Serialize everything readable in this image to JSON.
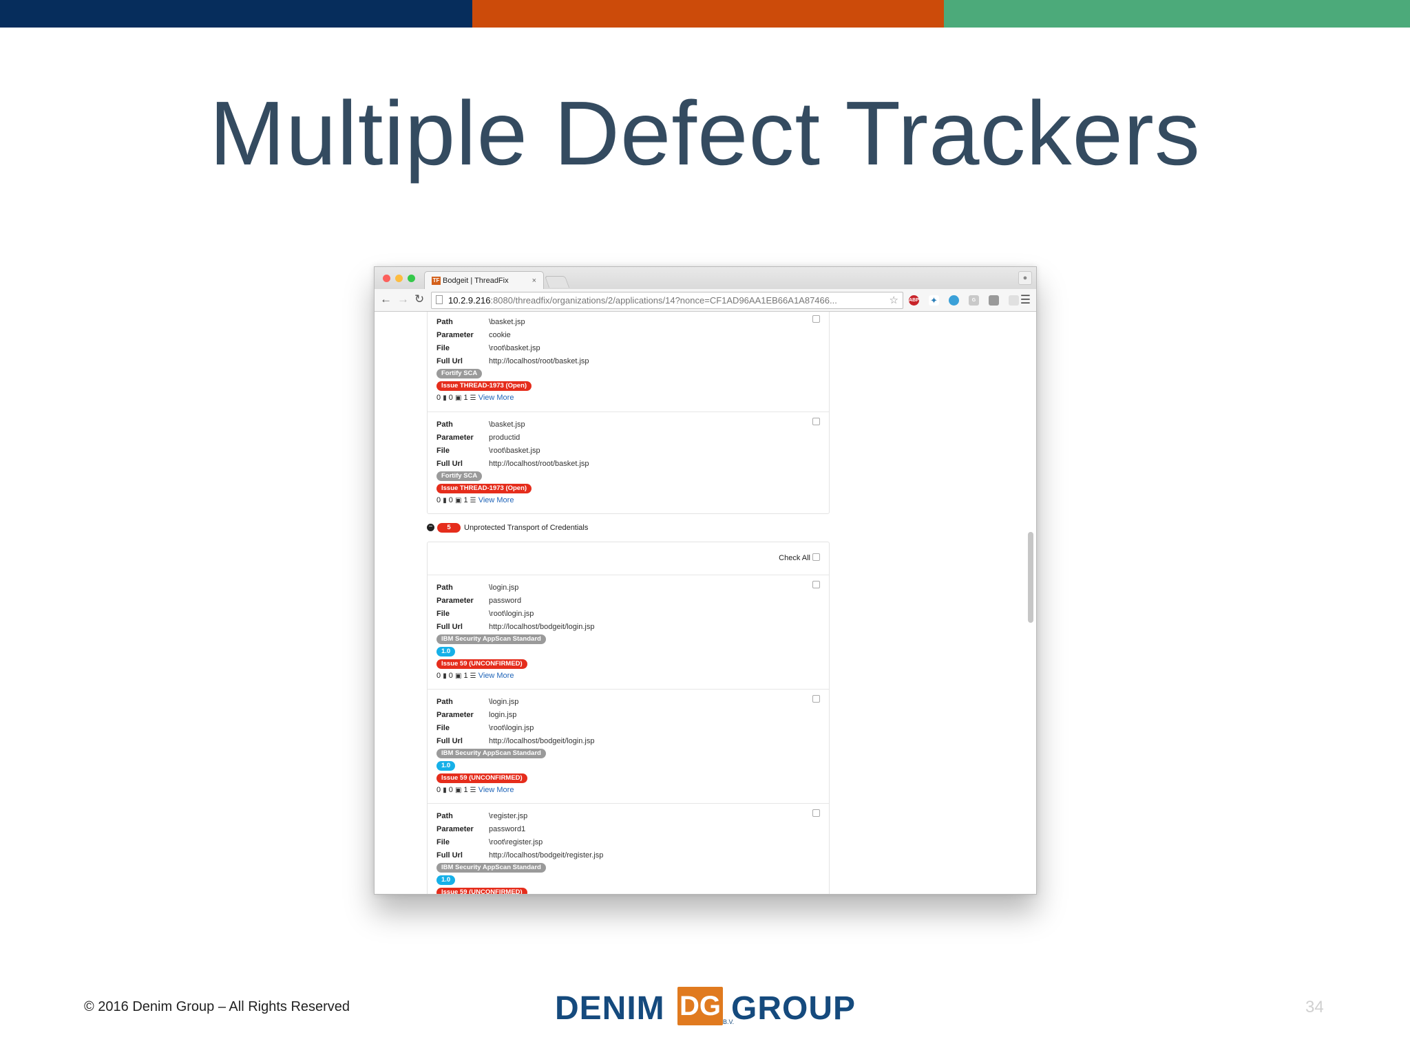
{
  "colors": {
    "band1": "#062d5c",
    "band2": "#cc4b0a",
    "band3": "#4caa7a",
    "title": "#344b60",
    "red_badge": "#e52d1c",
    "blue_badge": "#16b0e8",
    "gray_badge": "#9a9a9a",
    "logo_blue": "#154a7d",
    "logo_orange": "#e07a1f"
  },
  "slide": {
    "title": "Multiple Defect Trackers",
    "copyright": "© 2016 Denim Group – All Rights Reserved",
    "page_number": "34"
  },
  "logo": {
    "word1": "DENIM",
    "word2": "GROUP",
    "mark": "DG",
    "suffix": "B.V."
  },
  "browser": {
    "tab_title": "Bodgeit | ThreadFix",
    "tab_close": "×",
    "favicon": "TF",
    "url_host": "10.2.9.216",
    "url_rest": ":8080/threadfix/organizations/2/applications/14?nonce=CF1AD96AA1EB66A1A87466...",
    "icons": {
      "back": "back-icon",
      "forward": "forward-icon",
      "reload": "reload-icon",
      "star": "star-icon",
      "menu": "hamburger-menu-icon",
      "profile": "profile-icon"
    },
    "extensions": [
      "ABP",
      "",
      "",
      "G",
      "",
      "",
      "B"
    ]
  },
  "labels": {
    "path": "Path",
    "parameter": "Parameter",
    "file": "File",
    "full_url": "Full Url",
    "view_more": "View More",
    "check_all": "Check All"
  },
  "group1_findings": [
    {
      "path": "\\basket.jsp",
      "parameter": "cookie",
      "file": "\\root\\basket.jsp",
      "full_url": "http://localhost/root/basket.jsp",
      "scanner": "Fortify SCA",
      "issue": "Issue THREAD-1973 (Open)",
      "comments": "0",
      "files": "0",
      "count": "1"
    },
    {
      "path": "\\basket.jsp",
      "parameter": "productid",
      "file": "\\root\\basket.jsp",
      "full_url": "http://localhost/root/basket.jsp",
      "scanner": "Fortify SCA",
      "issue": "Issue THREAD-1973 (Open)",
      "comments": "0",
      "files": "0",
      "count": "1"
    }
  ],
  "vulnerability": {
    "count": "5",
    "name": "Unprotected Transport of Credentials"
  },
  "group2_findings": [
    {
      "path": "\\login.jsp",
      "parameter": "password",
      "file": "\\root\\login.jsp",
      "full_url": "http://localhost/bodgeit/login.jsp",
      "scanner": "IBM Security AppScan Standard",
      "version": "1.0",
      "issue": "Issue 59 (UNCONFIRMED)",
      "comments": "0",
      "files": "0",
      "count": "1"
    },
    {
      "path": "\\login.jsp",
      "parameter": "login.jsp",
      "file": "\\root\\login.jsp",
      "full_url": "http://localhost/bodgeit/login.jsp",
      "scanner": "IBM Security AppScan Standard",
      "version": "1.0",
      "issue": "Issue 59 (UNCONFIRMED)",
      "comments": "0",
      "files": "0",
      "count": "1"
    },
    {
      "path": "\\register.jsp",
      "parameter": "password1",
      "file": "\\root\\register.jsp",
      "full_url": "http://localhost/bodgeit/register.jsp",
      "scanner": "IBM Security AppScan Standard",
      "version": "1.0",
      "issue": "Issue 59 (UNCONFIRMED)"
    }
  ]
}
